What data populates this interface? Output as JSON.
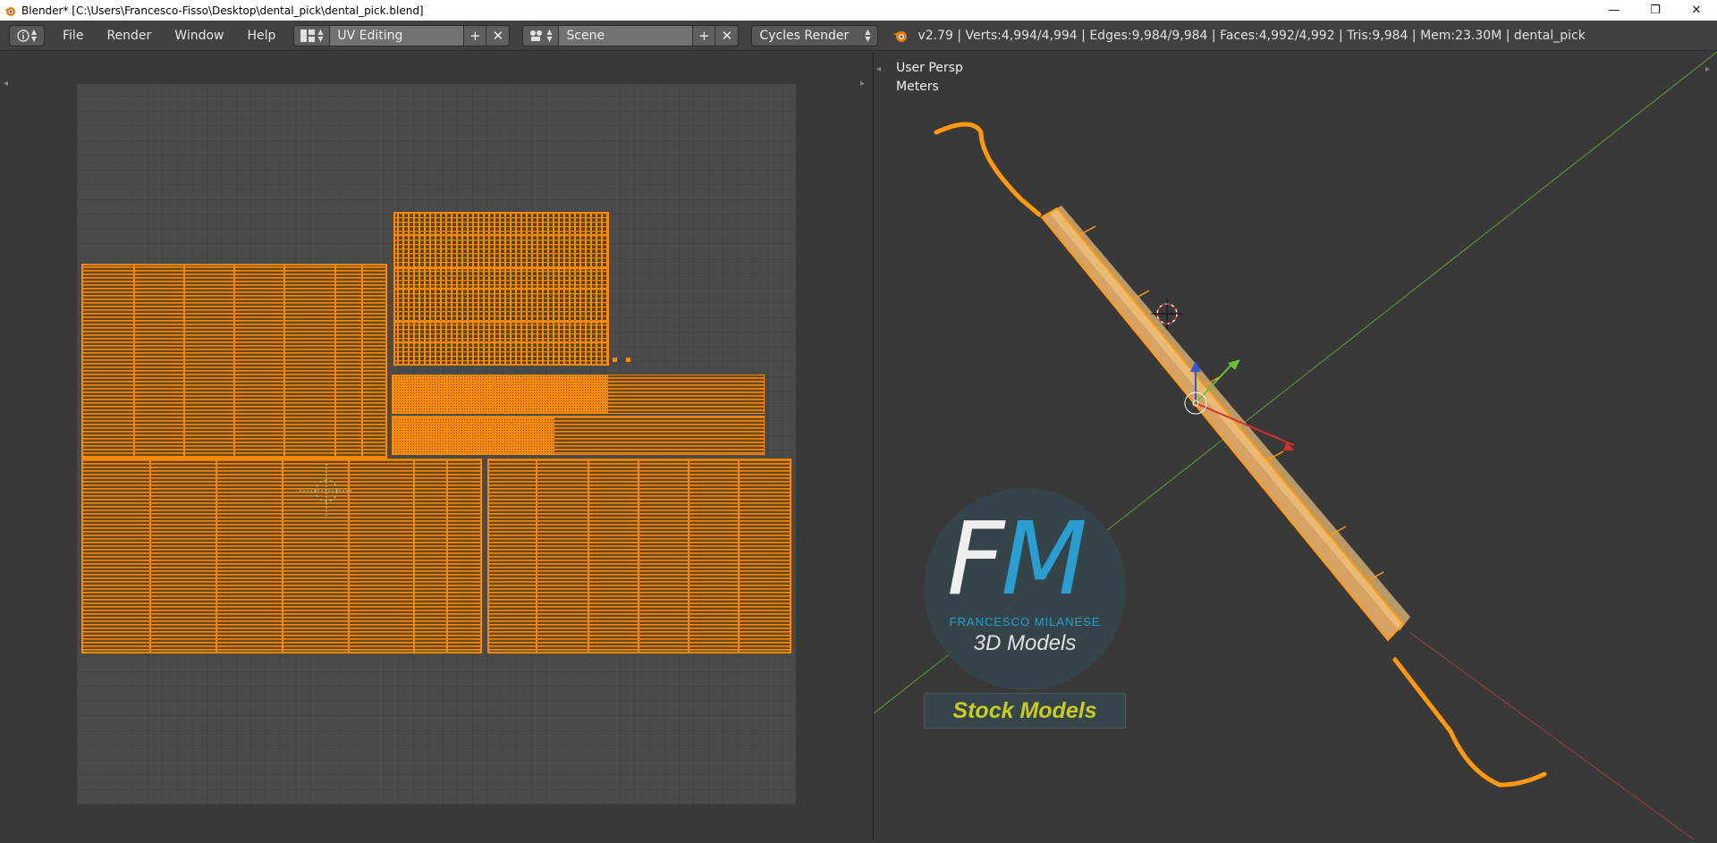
{
  "window": {
    "title": "Blender* [C:\\Users\\Francesco-Fisso\\Desktop\\dental_pick\\dental_pick.blend]",
    "minimize": "—",
    "restore": "❐",
    "close": "✕"
  },
  "header": {
    "menus": [
      "File",
      "Render",
      "Window",
      "Help"
    ],
    "screen_layout": "UV Editing",
    "scene": "Scene",
    "render_engine": "Cycles Render",
    "stats": "v2.79 | Verts:4,994/4,994 | Edges:9,984/9,984 | Faces:4,992/4,992 | Tris:9,984 | Mem:23.30M | dental_pick"
  },
  "viewport": {
    "view_name": "User Persp",
    "units": "Meters"
  },
  "watermark": {
    "letter_f": "F",
    "letter_m": "M",
    "brand": "FRANCESCO MILANESE",
    "subtitle": "3D Models",
    "badge": "Stock Models"
  },
  "colors": {
    "uv_orange": "#ff8a00",
    "grid_bg": "#4a4a4a",
    "logo_blue": "#2aa6dd",
    "badge_yellow": "#c9cc20"
  }
}
